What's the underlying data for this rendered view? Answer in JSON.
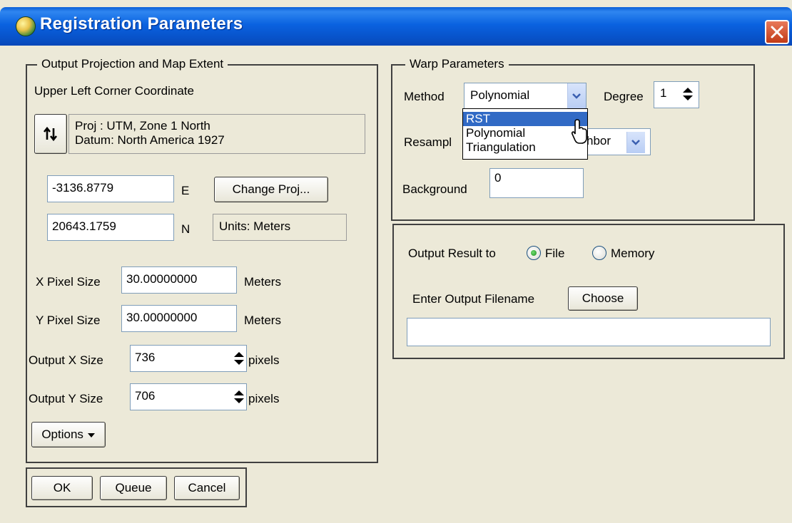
{
  "window": {
    "title": "Registration Parameters",
    "title_icon": "globe-icon",
    "close_icon": "close-icon"
  },
  "output_group": {
    "legend": "Output Projection and Map Extent",
    "coord_label": "Upper Left Corner Coordinate",
    "swap_icon": "swap-arrows-icon",
    "proj_line": "Proj : UTM, Zone 1 North",
    "datum_line": "Datum: North America 1927",
    "easting_value": "-3136.8779",
    "easting_unit": "E",
    "change_proj_label": "Change Proj...",
    "northing_value": "20643.1759",
    "northing_unit": "N",
    "units_label": "Units: Meters",
    "x_pixel_label": "X Pixel Size",
    "x_pixel_value": "30.00000000",
    "x_pixel_unit": "Meters",
    "y_pixel_label": "Y Pixel Size",
    "y_pixel_value": "30.00000000",
    "y_pixel_unit": "Meters",
    "out_x_label": "Output X Size",
    "out_x_value": "736",
    "out_x_unit": "pixels",
    "out_y_label": "Output Y Size",
    "out_y_value": "706",
    "out_y_unit": "pixels",
    "options_label": "Options"
  },
  "warp_group": {
    "legend": "Warp Parameters",
    "method_label": "Method",
    "method_value": "Polynomial",
    "degree_label": "Degree",
    "degree_value": "1",
    "method_options": [
      "RST",
      "Polynomial",
      "Triangulation"
    ],
    "resample_label_visible": "Resampl",
    "resample_value_visible": "hbor",
    "background_label": "Background",
    "background_value": "0"
  },
  "output_panel": {
    "output_result_label": "Output Result to",
    "file_label": "File",
    "memory_label": "Memory",
    "selected": "File",
    "filename_label": "Enter Output Filename",
    "choose_label": "Choose",
    "filename_value": ""
  },
  "footer": {
    "ok_label": "OK",
    "queue_label": "Queue",
    "cancel_label": "Cancel"
  },
  "colors": {
    "titlebar": "#0a5fd8",
    "dialog_bg": "#ece9d8",
    "selection": "#316ac5",
    "close_button": "#c23b16"
  }
}
